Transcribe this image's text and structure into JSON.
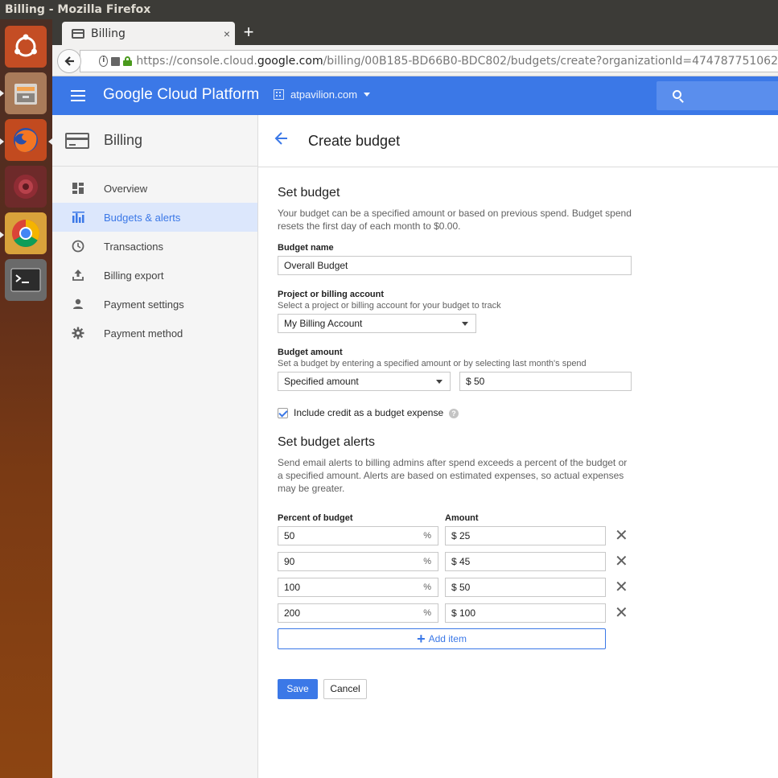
{
  "window": {
    "title": "Billing - Mozilla Firefox"
  },
  "browser": {
    "tab_title": "Billing",
    "tab_close": "×",
    "new_tab": "+",
    "url_prefix": "https://console.cloud.",
    "url_domain": "google.com",
    "url_path": "/billing/00B185-BD66B0-BDC802/budgets/create?organizationId=474787751062"
  },
  "header": {
    "product": "Google Cloud Platform",
    "project": "atpavilion.com"
  },
  "sidebar": {
    "title": "Billing",
    "items": [
      {
        "label": "Overview",
        "icon": "dashboard-icon",
        "active": false
      },
      {
        "label": "Budgets & alerts",
        "icon": "budget-chart-icon",
        "active": true
      },
      {
        "label": "Transactions",
        "icon": "clock-icon",
        "active": false
      },
      {
        "label": "Billing export",
        "icon": "upload-icon",
        "active": false
      },
      {
        "label": "Payment settings",
        "icon": "person-icon",
        "active": false
      },
      {
        "label": "Payment method",
        "icon": "gear-icon",
        "active": false
      }
    ]
  },
  "main": {
    "page_title": "Create budget",
    "set_budget": {
      "title": "Set budget",
      "description": "Your budget can be a specified amount or based on previous spend. Budget spend resets the first day of each month to $0.00.",
      "budget_name_label": "Budget name",
      "budget_name_value": "Overall Budget",
      "project_label": "Project or billing account",
      "project_help": "Select a project or billing account for your budget to track",
      "project_value": "My Billing Account",
      "amount_label": "Budget amount",
      "amount_help": "Set a budget by entering a specified amount or by selecting last month's spend",
      "amount_type_value": "Specified amount",
      "amount_value": "$ 50",
      "include_credit_label": "Include credit as a budget expense",
      "include_credit_checked": true,
      "help_glyph": "?"
    },
    "alerts": {
      "title": "Set budget alerts",
      "description": "Send email alerts to billing admins after spend exceeds a percent of the budget or a specified amount. Alerts are based on estimated expenses, so actual expenses may be greater.",
      "col_percent": "Percent of budget",
      "col_amount": "Amount",
      "percent_suffix": "%",
      "remove_glyph": "✕",
      "rows": [
        {
          "percent": "50",
          "amount": "$ 25"
        },
        {
          "percent": "90",
          "amount": "$ 45"
        },
        {
          "percent": "100",
          "amount": "$ 50"
        },
        {
          "percent": "200",
          "amount": "$ 100"
        }
      ],
      "add_item_label": "Add item"
    },
    "save_label": "Save",
    "cancel_label": "Cancel"
  },
  "colors": {
    "accent": "#3b78e7",
    "active_nav_bg": "#dce7fc"
  }
}
